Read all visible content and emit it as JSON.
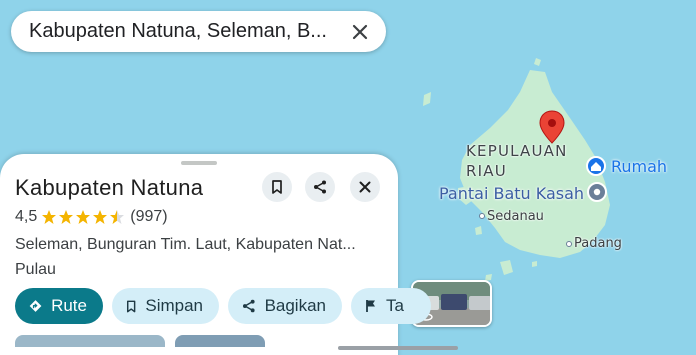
{
  "search": {
    "query": "Kabupaten Natuna, Seleman, B..."
  },
  "map": {
    "region_label_lines": [
      "KEPULAUAN",
      "RIAU"
    ],
    "places": {
      "home": "Rumah",
      "beach": "Pantai Batu Kasah",
      "town1": "Sedanau",
      "town2": "Padang"
    },
    "colors": {
      "water": "#8fd3ea",
      "land": "#c8ecd2",
      "pin": "#ea4335"
    }
  },
  "sheet": {
    "title": "Kabupaten Natuna",
    "rating": "4,5",
    "rating_value": 4.5,
    "rating_max": 5,
    "review_count": "(997)",
    "address": "Seleman, Bunguran Tim. Laut, Kabupaten Nat...",
    "category": "Pulau",
    "actions": {
      "route": "Rute",
      "save": "Simpan",
      "share": "Bagikan",
      "label": "Ta"
    }
  }
}
